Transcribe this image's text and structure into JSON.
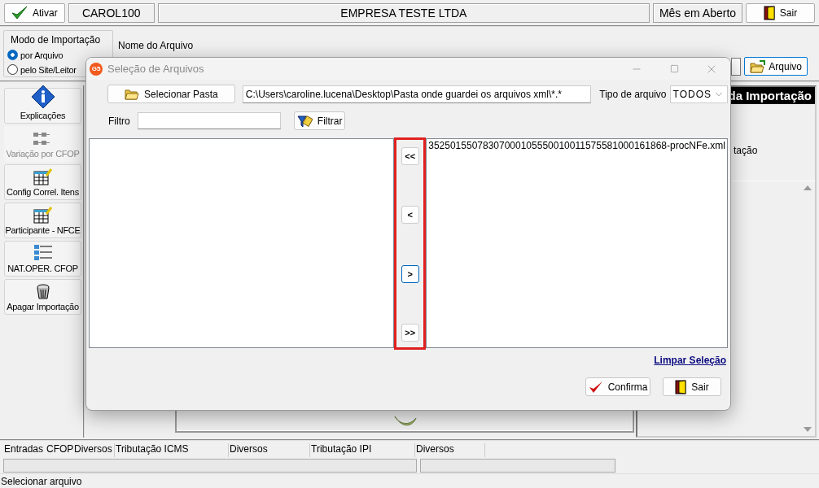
{
  "toolbar": {
    "activate_button": "Ativar",
    "user": "CAROL100",
    "company": "EMPRESA TESTE LTDA",
    "period": "Mês em Aberto",
    "exit_button": "Sair"
  },
  "import_mode": {
    "title": "Modo de Importação",
    "options": [
      {
        "label": "por Arquivo",
        "selected": true
      },
      {
        "label": "pelo Site/Leitor",
        "selected": false
      }
    ]
  },
  "file_name": {
    "label": "Nome do Arquivo",
    "button": "Arquivo"
  },
  "sidebar": {
    "items": [
      {
        "label": "Explicações",
        "kind": "info",
        "disabled": false
      },
      {
        "label": "Variação por CFOP",
        "kind": "grid",
        "disabled": true
      },
      {
        "label": "Config Correl. Itens",
        "kind": "table",
        "disabled": false
      },
      {
        "label": "Participante - NFCE",
        "kind": "table",
        "disabled": false
      },
      {
        "label": "NAT.OPER. CFOP",
        "kind": "list",
        "disabled": false
      },
      {
        "label": "Apagar Importação",
        "kind": "trash",
        "disabled": false
      }
    ]
  },
  "right_panel": {
    "header": "da Importação",
    "text": "tação"
  },
  "bottom_tabs": [
    "Entradas",
    "CFOP",
    "Diversos",
    "Tributação ICMS",
    "Diversos",
    "Tributação IPI",
    "Diversos"
  ],
  "status_bar": "Selecionar arquivo",
  "dialog": {
    "logo": "G5",
    "title": "Seleção de Arquivos",
    "select_folder_button": "Selecionar Pasta",
    "path": "C:\\Users\\caroline.lucena\\Desktop\\Pasta onde guardei os arquivos xml\\*.*",
    "file_type_label": "Tipo de arquivo",
    "file_type": "TODOS",
    "filter_label": "Filtro",
    "filter_button": "Filtrar",
    "selected_files": [
      "35250155078307000105550010011575581000161868-procNFe.xml"
    ],
    "move_buttons_highlighted": true,
    "move_buttons": [
      {
        "label": "<<",
        "focused": false
      },
      {
        "label": "<",
        "focused": false
      },
      {
        "label": ">",
        "focused": true
      },
      {
        "label": ">>",
        "focused": false
      }
    ],
    "clear_link": "Limpar Seleção",
    "confirm_button": "Confirma",
    "exit_button": "Sair"
  }
}
